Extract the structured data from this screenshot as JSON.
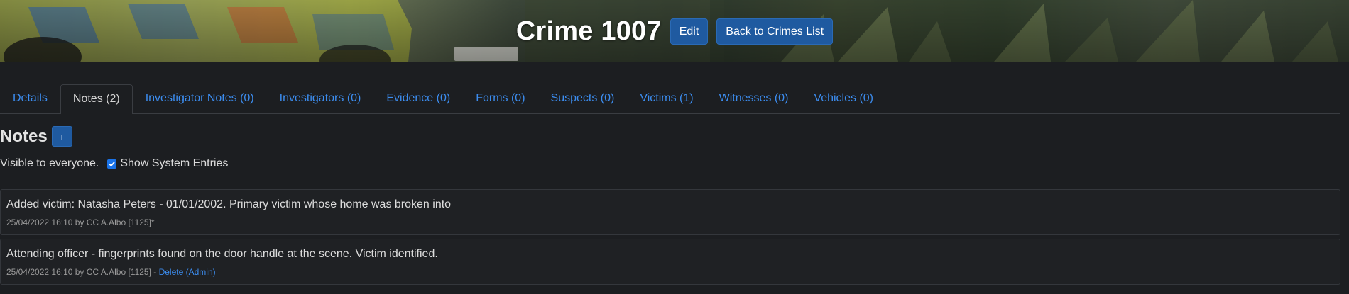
{
  "header": {
    "title": "Crime 1007",
    "edit_label": "Edit",
    "back_label": "Back to Crimes List"
  },
  "tabs": [
    {
      "label": "Details",
      "active": false
    },
    {
      "label": "Notes (2)",
      "active": true
    },
    {
      "label": "Investigator Notes (0)",
      "active": false
    },
    {
      "label": "Investigators (0)",
      "active": false
    },
    {
      "label": "Evidence (0)",
      "active": false
    },
    {
      "label": "Forms (0)",
      "active": false
    },
    {
      "label": "Suspects (0)",
      "active": false
    },
    {
      "label": "Victims (1)",
      "active": false
    },
    {
      "label": "Witnesses (0)",
      "active": false
    },
    {
      "label": "Vehicles (0)",
      "active": false
    }
  ],
  "notes": {
    "title": "Notes",
    "add_label": "+",
    "visibility_text": "Visible to everyone.",
    "show_system_label": "Show System Entries",
    "show_system_checked": true,
    "items": [
      {
        "text": "Added victim: Natasha Peters - 01/01/2002. Primary victim whose home was broken into",
        "meta": "25/04/2022 16:10 by CC A.Albo [1125]*",
        "delete_label": ""
      },
      {
        "text": "Attending officer - fingerprints found on the door handle at the scene. Victim identified.",
        "meta": "25/04/2022 16:10 by CC A.Albo [1125] - ",
        "delete_label": "Delete (Admin)"
      }
    ]
  },
  "colors": {
    "accent": "#1f5aa0",
    "link": "#3c8df0",
    "background": "#1c1e21"
  }
}
